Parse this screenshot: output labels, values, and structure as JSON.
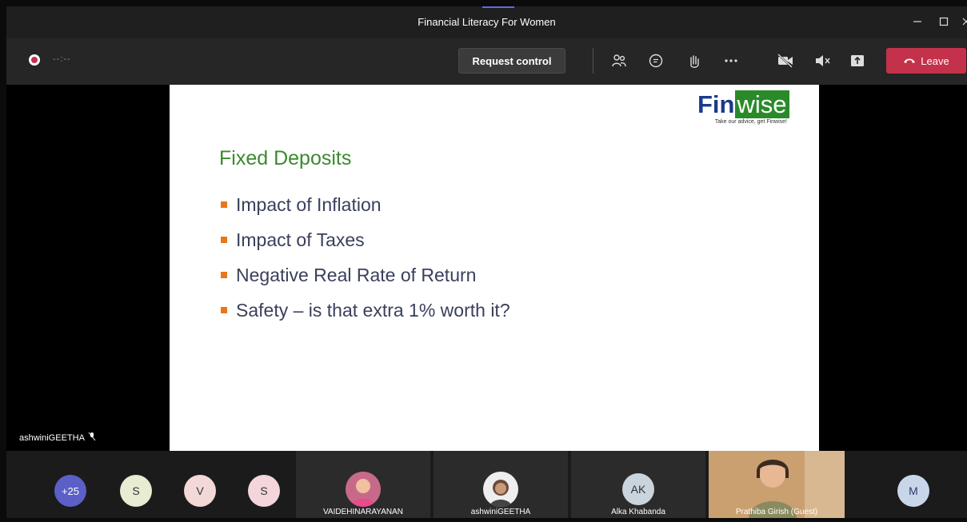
{
  "window": {
    "title": "Financial Literacy For Women"
  },
  "toolbar": {
    "timer": "--:--",
    "request_control_label": "Request control",
    "leave_label": "Leave",
    "icons": [
      "people-icon",
      "chat-icon",
      "raise-hand-icon",
      "more-icon",
      "camera-off-icon",
      "mute-icon",
      "share-icon"
    ]
  },
  "slide": {
    "logo_fin": "Fin",
    "logo_wise": "wise",
    "logo_tagline": "Take our advice, get Finwise!",
    "title": "Fixed Deposits",
    "bullets": [
      "Impact of Inflation",
      "Impact of Taxes",
      "Negative Real Rate of Return",
      "Safety – is that extra 1% worth it?"
    ]
  },
  "presenter": {
    "name": "ashwiniGEETHA"
  },
  "participants": {
    "overflow_count": "+25",
    "avatars": [
      "S",
      "V",
      "S"
    ],
    "tiles": [
      {
        "name": "VAIDEHINARAYANAN"
      },
      {
        "name": "ashwiniGEETHA"
      },
      {
        "initials": "AK",
        "name": "Alka Khabanda"
      },
      {
        "name": "Prathiba Girish (Guest)"
      }
    ],
    "last_avatar": "M"
  },
  "colors": {
    "leave": "#c4314b",
    "slide_title": "#3b8a2e",
    "bullet": "#e8771a",
    "overflow": "#5b5fc7"
  }
}
